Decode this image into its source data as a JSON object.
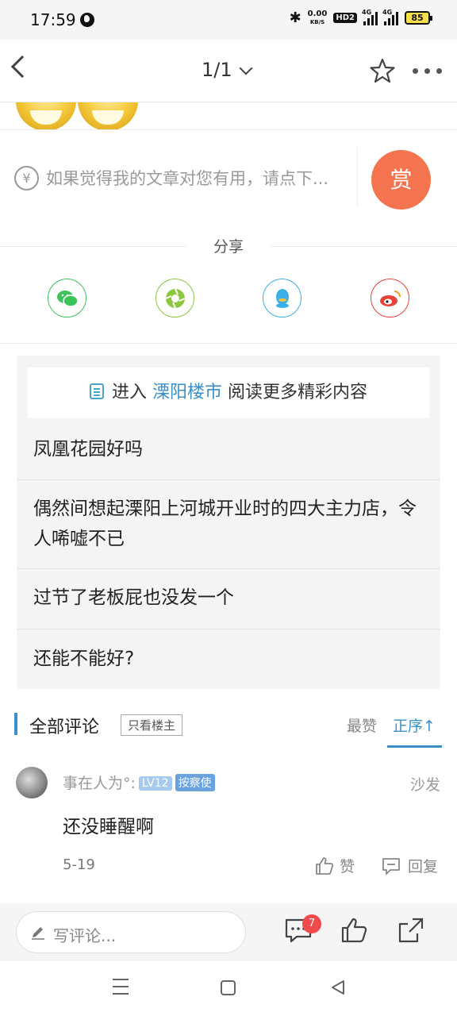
{
  "status_bar": {
    "time": "17:59",
    "speed_value": "0.00",
    "speed_unit": "KB/S",
    "hd_badge": "HD2",
    "network_1": "4G",
    "network_2": "4G",
    "battery": "85",
    "icons": [
      "globe-icon",
      "bluetooth-icon",
      "signal-icon",
      "battery-icon"
    ]
  },
  "nav": {
    "page_indicator": "1/1",
    "icons": [
      "back-arrow-icon",
      "chevron-down-icon",
      "star-icon",
      "more-icon"
    ]
  },
  "reward": {
    "currency_symbol": "¥",
    "prompt": "如果觉得我的文章对您有用，请点下...",
    "button_label": "赏"
  },
  "share": {
    "title": "分享",
    "platforms": [
      "wechat-icon",
      "moments-icon",
      "qq-icon",
      "weibo-icon"
    ]
  },
  "related": {
    "enter_prefix": "进入",
    "forum_name": "溧阳楼市",
    "enter_suffix": "阅读更多精彩内容",
    "items": [
      "凤凰花园好吗",
      "偶然间想起溧阳上河城开业时的四大主力店，令人唏嘘不已",
      "过节了老板屁也没发一个",
      "还能不能好?"
    ]
  },
  "comments": {
    "title": "全部评论",
    "filter_label": "只看楼主",
    "sort_best": "最赞",
    "sort_order": "正序↑",
    "list": [
      {
        "user": "事在人为°:",
        "level": "LV12",
        "role": "按察使",
        "floor": "沙发",
        "text": "还没睡醒啊",
        "date": "5-19",
        "like_label": "赞",
        "reply_label": "回复"
      }
    ]
  },
  "bottom_bar": {
    "write_placeholder": "写评论...",
    "comment_count_badge": "7"
  },
  "colors": {
    "accent": "#3a8fc8",
    "reward_button": "#f3744f",
    "badge_red": "#f04a4a"
  }
}
